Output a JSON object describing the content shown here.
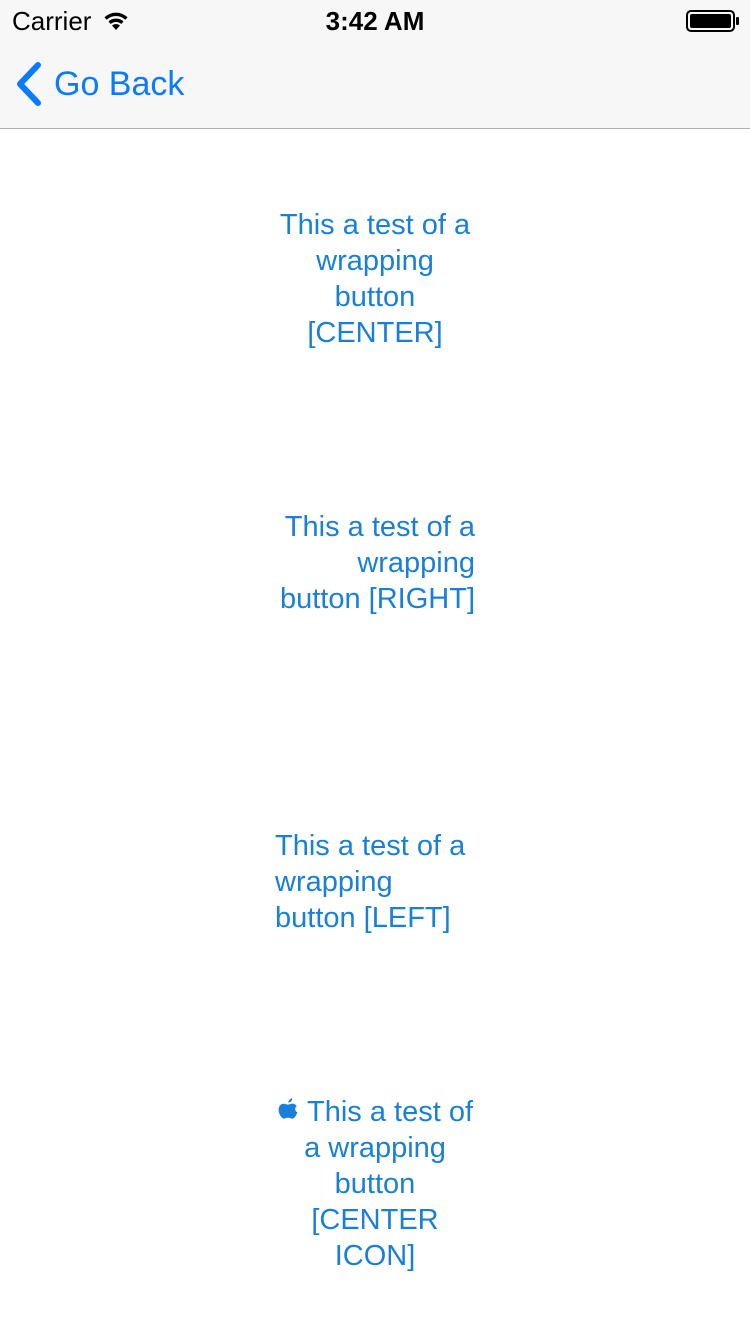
{
  "status_bar": {
    "carrier": "Carrier",
    "time": "3:42 AM",
    "wifi_icon": "wifi-icon",
    "battery_icon": "battery-full-icon"
  },
  "nav": {
    "back_label": "Go Back",
    "back_icon": "chevron-left-icon",
    "tint_color": "#0a7aff"
  },
  "buttons": {
    "center": {
      "label": "This a test of a wrapping button [CENTER]",
      "alignment": "center"
    },
    "right": {
      "label": "This a test of a wrapping button [RIGHT]",
      "alignment": "right"
    },
    "left": {
      "label": "This a test of a wrapping button [LEFT]",
      "alignment": "left"
    },
    "center_icon": {
      "icon": "apple-icon",
      "label": "This a test of a wrapping button [CENTER ICON]",
      "alignment": "center"
    },
    "text_color": "#1a7fd9"
  }
}
